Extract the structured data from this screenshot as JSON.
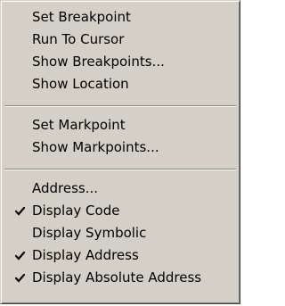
{
  "menu": {
    "groups": [
      {
        "items": [
          {
            "label": "Set Breakpoint",
            "checked": false
          },
          {
            "label": "Run To Cursor",
            "checked": false
          },
          {
            "label": "Show Breakpoints...",
            "checked": false
          },
          {
            "label": "Show Location",
            "checked": false
          }
        ]
      },
      {
        "items": [
          {
            "label": "Set Markpoint",
            "checked": false
          },
          {
            "label": "Show Markpoints...",
            "checked": false
          }
        ]
      },
      {
        "items": [
          {
            "label": "Address...",
            "checked": false
          },
          {
            "label": "Display Code",
            "checked": true
          },
          {
            "label": "Display Symbolic",
            "checked": false
          },
          {
            "label": "Display Address",
            "checked": true
          },
          {
            "label": "Display Absolute Address",
            "checked": true
          }
        ]
      }
    ]
  },
  "colors": {
    "menu_background": "#d4d0c8",
    "text": "#000000",
    "separator_dark": "#808080",
    "separator_light": "#ffffff"
  },
  "icons": {
    "checked_item": "checkmark-icon"
  }
}
